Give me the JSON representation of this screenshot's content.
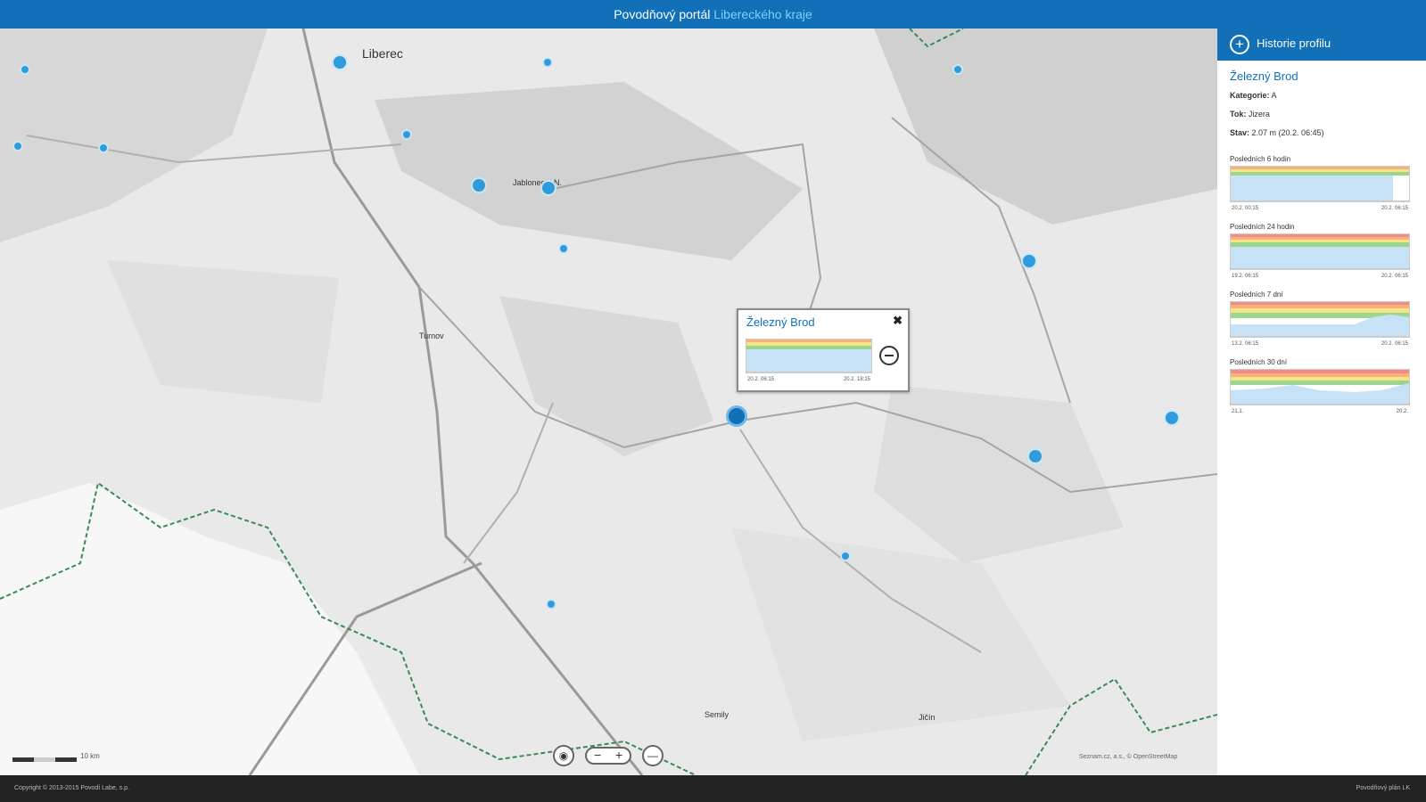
{
  "header": {
    "title_main": "Povodňový portál",
    "title_accent": "Libereckého kraje"
  },
  "map": {
    "places": [
      "Liberec",
      "Turnov",
      "Jablonec n.N.",
      "Semily",
      "Jičín"
    ],
    "popup": {
      "title": "Železný Brod",
      "close_label": "✖",
      "axis_start": "20.2. 06:15",
      "axis_end": "20.2. 18:15"
    },
    "scale_label": "10 km",
    "attribution": "Seznam.cz, a.s., © OpenStreetMap"
  },
  "sidebar": {
    "header_label": "Historie profilu",
    "station": "Železný Brod",
    "category_label": "Kategorie:",
    "category_value": "A",
    "river_label": "Tok:",
    "river_value": "Jizera",
    "state_label": "Stav:",
    "state_value": "2.07 m (20.2. 06:45)",
    "charts": [
      {
        "title": "Posledních 6 hodin",
        "start": "20.2. 00:15",
        "end": "20.2. 06:15"
      },
      {
        "title": "Posledních 24 hodin",
        "start": "19.2. 06:15",
        "end": "20.2. 06:15"
      },
      {
        "title": "Posledních 7 dní",
        "start": "13.2. 06:15",
        "end": "20.2. 06:15"
      },
      {
        "title": "Posledních 30 dní",
        "start": "21.1.",
        "end": "20.2."
      }
    ]
  },
  "footer": {
    "copyright": "Copyright © 2013-2015 Povodí Labe, s.p.",
    "right": "Povodňový plán LK"
  },
  "colors": {
    "header_bg": "#1170b8",
    "accent": "#7fd0ff",
    "marker": "#2f9bd9",
    "footer_bg": "#222222"
  }
}
